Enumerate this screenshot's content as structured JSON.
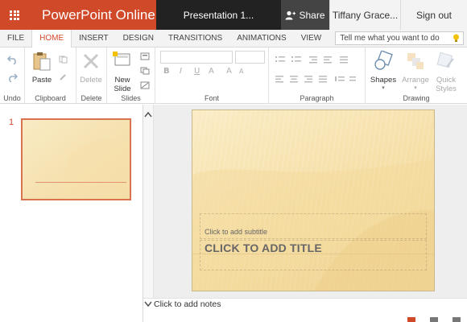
{
  "app": {
    "name": "PowerPoint Online",
    "doc_title": "Presentation 1...",
    "share_label": "Share",
    "user": "Tiffany Grace...",
    "sign_out": "Sign out"
  },
  "tabs": [
    {
      "label": "FILE"
    },
    {
      "label": "HOME"
    },
    {
      "label": "INSERT"
    },
    {
      "label": "DESIGN"
    },
    {
      "label": "TRANSITIONS"
    },
    {
      "label": "ANIMATIONS"
    },
    {
      "label": "VIEW"
    }
  ],
  "tellme": {
    "placeholder": "Tell me what you want to do"
  },
  "ribbon": {
    "undo_group": "Undo",
    "clipboard": {
      "label": "Clipboard",
      "paste": "Paste"
    },
    "delete": {
      "label": "Delete",
      "button": "Delete"
    },
    "slides": {
      "label": "Slides",
      "new_slide_line1": "New",
      "new_slide_line2": "Slide"
    },
    "font": {
      "label": "Font",
      "bold": "B",
      "italic": "I",
      "underline": "U",
      "font_color": "A",
      "grow": "A",
      "shrink": "A"
    },
    "paragraph": {
      "label": "Paragraph"
    },
    "drawing": {
      "label": "Drawing",
      "shapes": "Shapes",
      "arrange": "Arrange",
      "quick_styles_1": "Quick",
      "quick_styles_2": "Styles"
    }
  },
  "slides_panel": {
    "slide_number": "1"
  },
  "slide": {
    "subtitle_placeholder": "Click to add subtitle",
    "title_placeholder": "CLICK TO ADD TITLE"
  },
  "notes": {
    "placeholder": "Click to add notes"
  },
  "colors": {
    "brand": "#d04a2a",
    "slide_bg": "#f7e4b3",
    "title_dark": "#222222"
  }
}
